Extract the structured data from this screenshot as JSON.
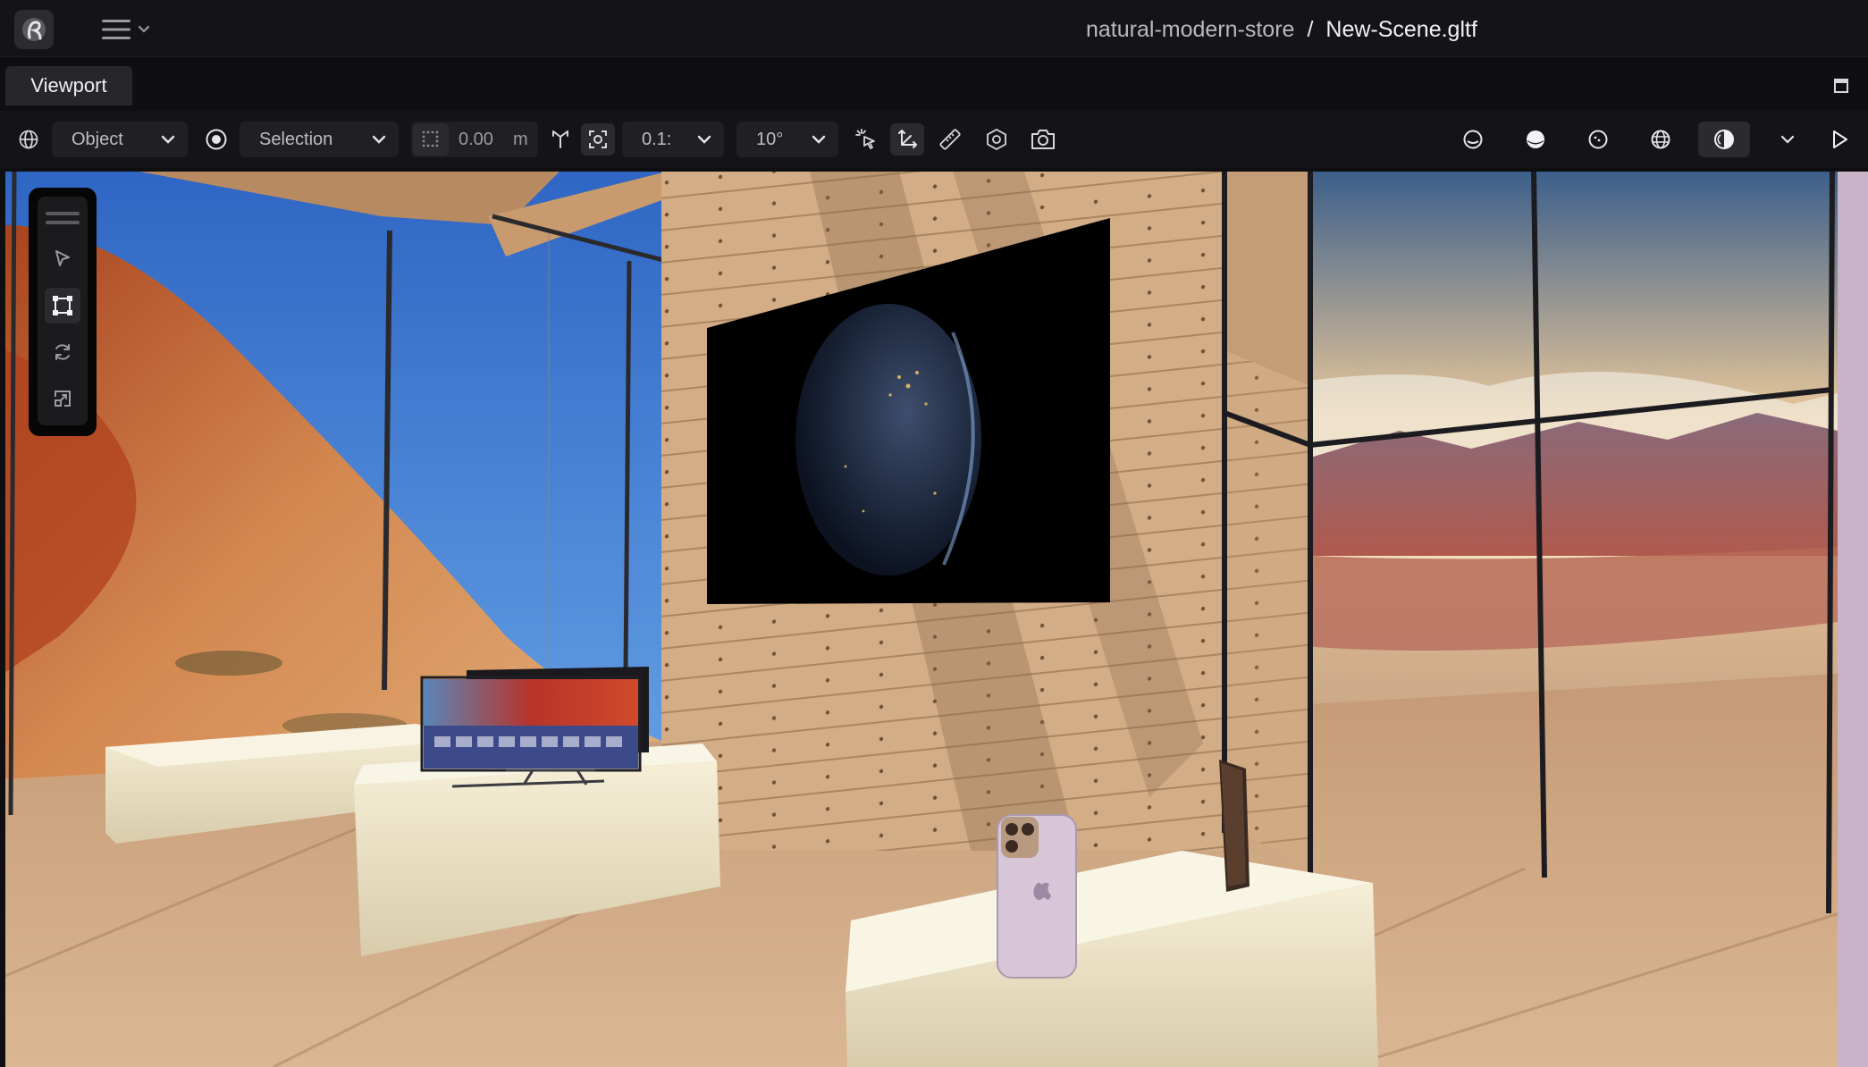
{
  "header": {
    "project_name": "natural-modern-store",
    "separator": "/",
    "file_name": "New-Scene.gltf"
  },
  "tabs": [
    {
      "label": "Viewport",
      "active": true
    }
  ],
  "toolbar": {
    "space_mode": "Object",
    "pivot_mode": "Selection",
    "grid_snap_value": "0.00",
    "grid_snap_unit": "m",
    "translation_snap": "0.1:",
    "rotation_snap": "10°"
  },
  "viewport": {
    "tool_palette": [
      "select",
      "move",
      "rotate",
      "scale"
    ],
    "active_tool": "move"
  },
  "colors": {
    "accent": "#141416",
    "sky": "#3f78c8",
    "sand": "#c9703c",
    "wood": "#d9b48e",
    "pedestal": "#efe6c9"
  }
}
